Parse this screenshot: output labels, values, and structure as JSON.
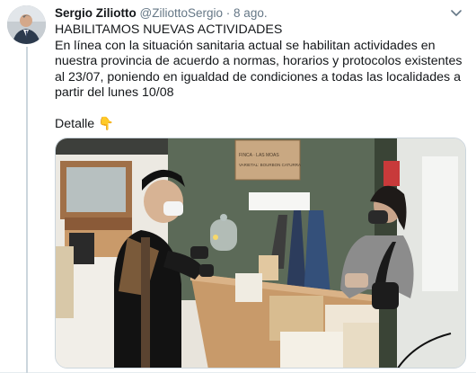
{
  "tweet": {
    "author_name": "Sergio Ziliotto",
    "handle": "@ZiliottoSergio",
    "separator": "·",
    "date": "8 ago.",
    "text": "HABILITAMOS NUEVAS ACTIVIDADES\nEn línea con la situación sanitaria actual se habilitan actividades en nuestra provincia de acuerdo a normas, horarios y protocolos existentes al 23/07, poniendo en igualdad de condiciones a todas las localidades a partir del lunes 10/08\n\nDetalle 👇"
  },
  "media": {
    "sign_line1": "FINCA · LAS MOAS",
    "sign_line2": "VARIETAL: BOURBON CATURRA"
  },
  "icons": {
    "more": "chevron-down-icon",
    "avatar": "avatar-photo"
  },
  "colors": {
    "text_primary": "#14171a",
    "text_secondary": "#657786",
    "border": "#e6ecf0"
  }
}
